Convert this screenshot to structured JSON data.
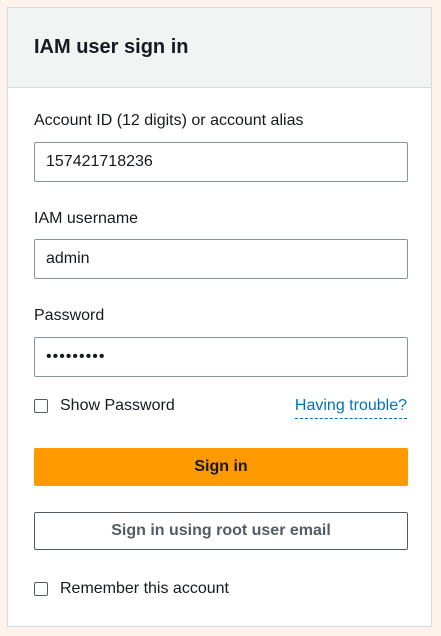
{
  "header": {
    "title": "IAM user sign in"
  },
  "account": {
    "label": "Account ID (12 digits) or account alias",
    "value": "157421718236"
  },
  "username": {
    "label": "IAM username",
    "value": "admin"
  },
  "password": {
    "label": "Password",
    "masked_value": "•••••••••"
  },
  "show_password": {
    "label": "Show Password",
    "checked": false
  },
  "trouble_link": {
    "label": "Having trouble?"
  },
  "sign_in_button": {
    "label": "Sign in"
  },
  "root_sign_in_button": {
    "label": "Sign in using root user email"
  },
  "remember_account": {
    "label": "Remember this account",
    "checked": false
  },
  "colors": {
    "primary_button": "#ff9900",
    "link": "#0073bb",
    "header_bg": "#f2f3f3"
  }
}
